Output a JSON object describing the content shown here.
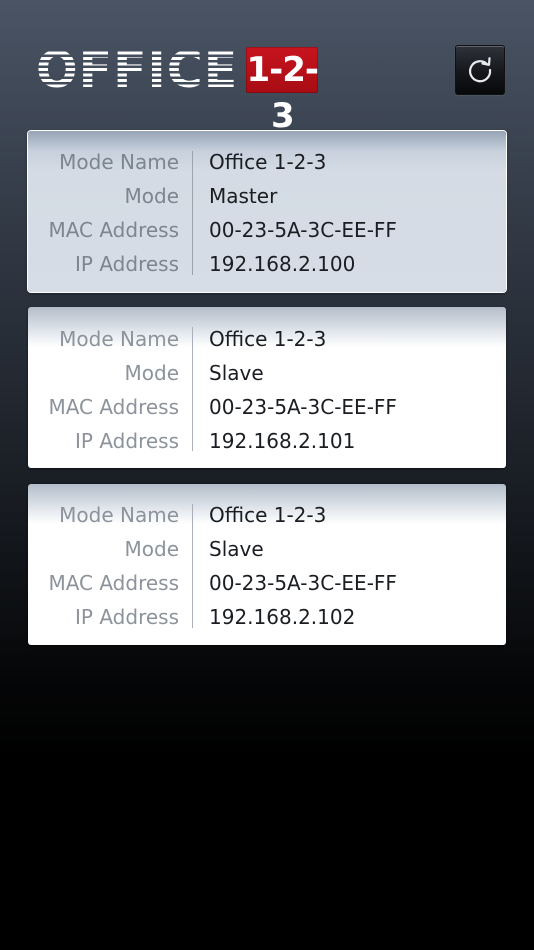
{
  "header": {
    "logo_word": "OFFICE",
    "logo_badge": "1-2-3",
    "refresh_icon": "refresh-icon"
  },
  "labels": {
    "mode_name": "Mode Name",
    "mode": "Mode",
    "mac": "MAC Address",
    "ip": "IP Address"
  },
  "devices": [
    {
      "mode_name": "Office 1-2-3",
      "mode": "Master",
      "mac": "00-23-5A-3C-EE-FF",
      "ip": "192.168.2.100",
      "selected": true
    },
    {
      "mode_name": "Office 1-2-3",
      "mode": "Slave",
      "mac": "00-23-5A-3C-EE-FF",
      "ip": "192.168.2.101",
      "selected": false
    },
    {
      "mode_name": "Office 1-2-3",
      "mode": "Slave",
      "mac": "00-23-5A-3C-EE-FF",
      "ip": "192.168.2.102",
      "selected": false
    }
  ],
  "colors": {
    "badge_red": "#c8141e",
    "label_gray": "#8d939b",
    "value_text": "#1a1d22"
  }
}
